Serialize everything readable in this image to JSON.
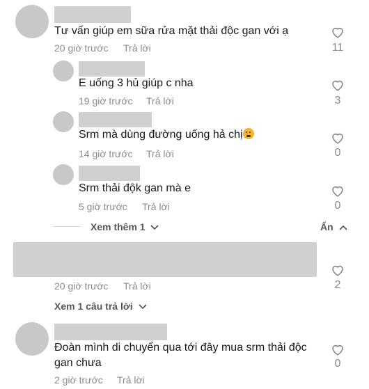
{
  "comments": [
    {
      "text": "Tư vấn giúp em sữa rửa mặt thải độc gan với ạ",
      "time": "20 giờ trước",
      "reply": "Trả lời",
      "likes": "11"
    },
    {
      "text": "E uống 3 hủ giúp c nha",
      "time": "19 giờ trước",
      "reply": "Trả lời",
      "likes": "3"
    },
    {
      "text": "Srm mà dùng đường uống hả chị",
      "time": "14 giờ trước",
      "reply": "Trả lời",
      "likes": "0"
    },
    {
      "text": "Srm thải độk gan mà e",
      "time": "5 giờ trước",
      "reply": "Trả lời",
      "likes": "0"
    },
    {
      "time": "20 giờ trước",
      "reply": "Trả lời",
      "likes": "2"
    },
    {
      "text": "Đoàn mình di chuyển qua tới đây mua srm thải độc gan chưa",
      "time": "2 giờ trước",
      "reply": "Trả lời",
      "likes": "0"
    }
  ],
  "see_more": "Xem thêm 1",
  "hide": "Ẩn",
  "see_replies": "Xem 1 câu trả lời",
  "icons": {
    "like": "heart-outline-icon",
    "chevron": "chevron-down-icon",
    "emoji": "flushed-face-emoji"
  },
  "colors": {
    "text": "#161823",
    "muted": "#8a8b91",
    "redacted": "#d0d0d0"
  }
}
